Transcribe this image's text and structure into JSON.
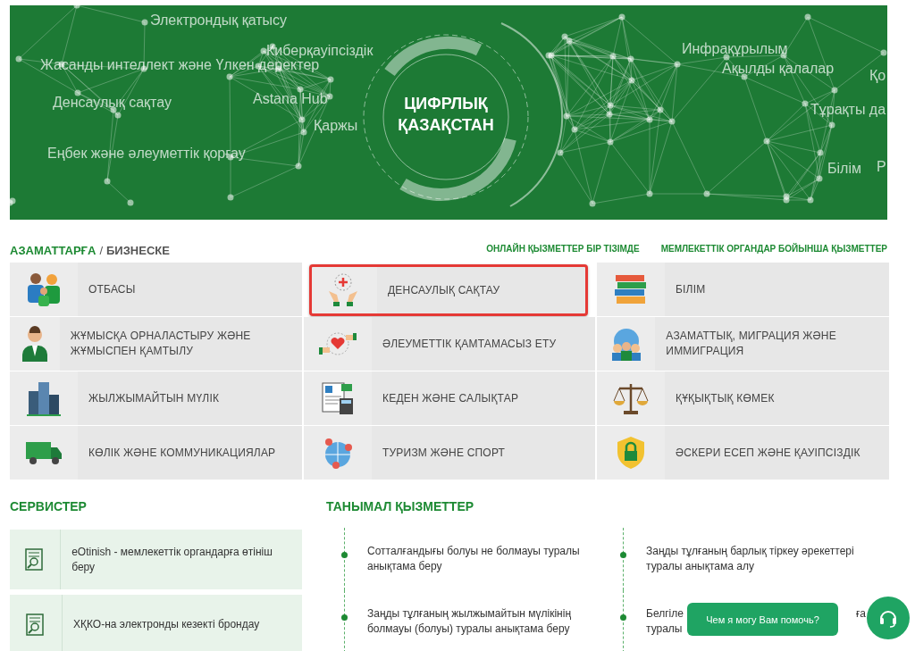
{
  "banner": {
    "title": "ЦИФРЛЫҚ ҚАЗАҚСТАН",
    "labels": [
      "Электрондық қатысу",
      "Киберқауіпсіздік",
      "Жасанды интеллект және Үлкен деректер",
      "Денсаулық сақтау",
      "Astana Hub",
      "Қаржы",
      "Еңбек және әлеуметтік қорғау",
      "Инфрақұрылым",
      "Ақылды қалалар",
      "Қо",
      "Тұрақты да",
      "Білім",
      "Р"
    ]
  },
  "tabs": [
    {
      "label": "АЗАМАТТАРҒА",
      "selected": true
    },
    {
      "label": "БИЗНЕСКЕ",
      "selected": false
    }
  ],
  "tab_separator": "/",
  "links": [
    "ОНЛАЙН ҚЫЗМЕТТЕР БІР ТІЗІМДЕ",
    "МЕМЛЕКЕТТІК ОРГАНДАР БОЙЫНША ҚЫЗМЕТТЕР"
  ],
  "categories": [
    {
      "label": "ОТБАСЫ",
      "highlighted": false
    },
    {
      "label": "ДЕНСАУЛЫҚ САҚТАУ",
      "highlighted": true
    },
    {
      "label": "БІЛІМ",
      "highlighted": false
    },
    {
      "label": "ЖҰМЫСҚА ОРНАЛАСТЫРУ ЖӘНЕ ЖҰМЫСПЕН ҚАМТЫЛУ",
      "highlighted": false
    },
    {
      "label": "ӘЛЕУМЕТТІК ҚАМТАМАСЫЗ ЕТУ",
      "highlighted": false
    },
    {
      "label": "АЗАМАТТЫҚ, МИГРАЦИЯ ЖӘНЕ ИММИГРАЦИЯ",
      "highlighted": false
    },
    {
      "label": "ЖЫЛЖЫМАЙТЫН МҮЛІК",
      "highlighted": false
    },
    {
      "label": "КЕДЕН ЖӘНЕ САЛЫҚТАР",
      "highlighted": false
    },
    {
      "label": "ҚҰҚЫҚТЫҚ КӨМЕК",
      "highlighted": false
    },
    {
      "label": "КӨЛІК ЖӘНЕ КОММУНИКАЦИЯЛАР",
      "highlighted": false
    },
    {
      "label": "ТУРИЗМ ЖӘНЕ СПОРТ",
      "highlighted": false
    },
    {
      "label": "ӘСКЕРИ ЕСЕП ЖӘНЕ ҚАУІПСІЗДІК",
      "highlighted": false
    }
  ],
  "services": {
    "title": "СЕРВИСТЕР",
    "items": [
      "eOtinish - мемлекеттік органдарға өтініш беру",
      "ХҚКО-на электронды кезекті брондау"
    ]
  },
  "popular": {
    "title": "ТАНЫМАЛ ҚЫЗМЕТТЕР",
    "items": [
      {
        "lines": [
          [
            "Сотталғандығы болуы не болмауы туралы"
          ],
          [
            "анықтама беру"
          ]
        ]
      },
      {
        "lines": [
          [
            "Заңды тұлғаның барлық тіркеу әрекеттері"
          ],
          [
            "туралы анықтама алу"
          ]
        ]
      },
      {
        "lines": [
          [
            "Заңды тұлғаның жылжымайтын мүлікінің"
          ],
          [
            "болмауы (болуы) туралы анықтама беру"
          ]
        ]
      },
      {
        "lines": [
          [
            "Белгіле",
            "ға"
          ],
          [
            "туралы"
          ]
        ]
      }
    ]
  },
  "chat": {
    "text": "Чем я могу Вам помочь?"
  }
}
